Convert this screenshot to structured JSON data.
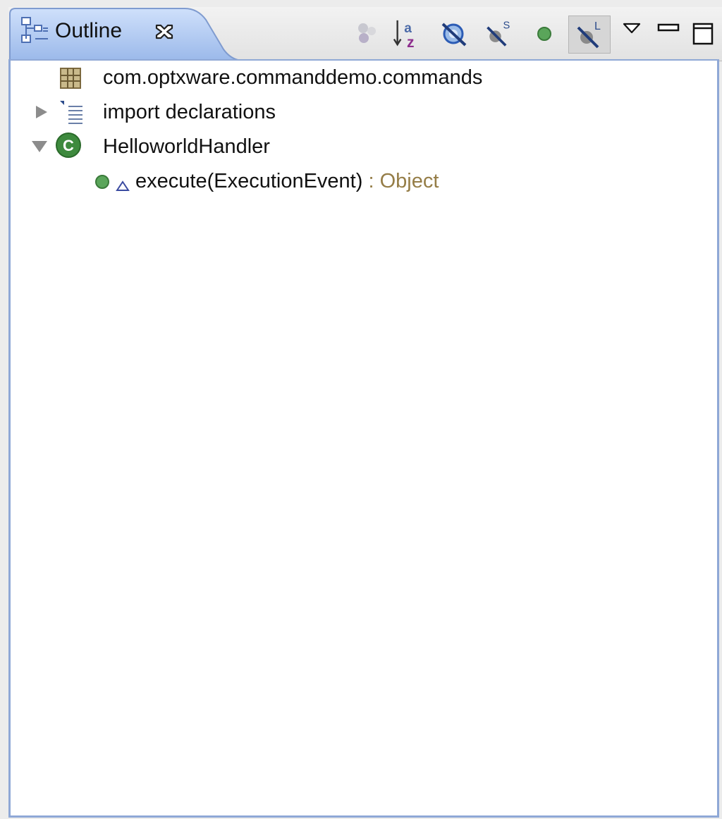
{
  "view": {
    "tab_title": "Outline",
    "toolbar": [
      {
        "name": "hide-fields-icon",
        "pressed": false
      },
      {
        "name": "sort-alphabetically-icon",
        "pressed": false
      },
      {
        "name": "hide-non-public-members-icon",
        "pressed": false
      },
      {
        "name": "hide-static-members-icon",
        "pressed": false
      },
      {
        "name": "hide-non-public-methods-icon",
        "pressed": false
      },
      {
        "name": "hide-local-types-icon",
        "pressed": true
      },
      {
        "name": "view-menu-icon",
        "pressed": false
      },
      {
        "name": "minimize-icon",
        "pressed": false
      },
      {
        "name": "maximize-icon",
        "pressed": false
      }
    ]
  },
  "tree": {
    "package": "com.optxware.commanddemo.commands",
    "imports": "import declarations",
    "class_name": "HelloworldHandler",
    "method_signature": "execute(ExecutionEvent)",
    "method_return": " : Object"
  },
  "colors": {
    "pane_border": "#8fa8d6",
    "return_type": "#957d47",
    "class_icon_green": "#3e8a3e",
    "method_icon_green": "#5aa55a"
  }
}
